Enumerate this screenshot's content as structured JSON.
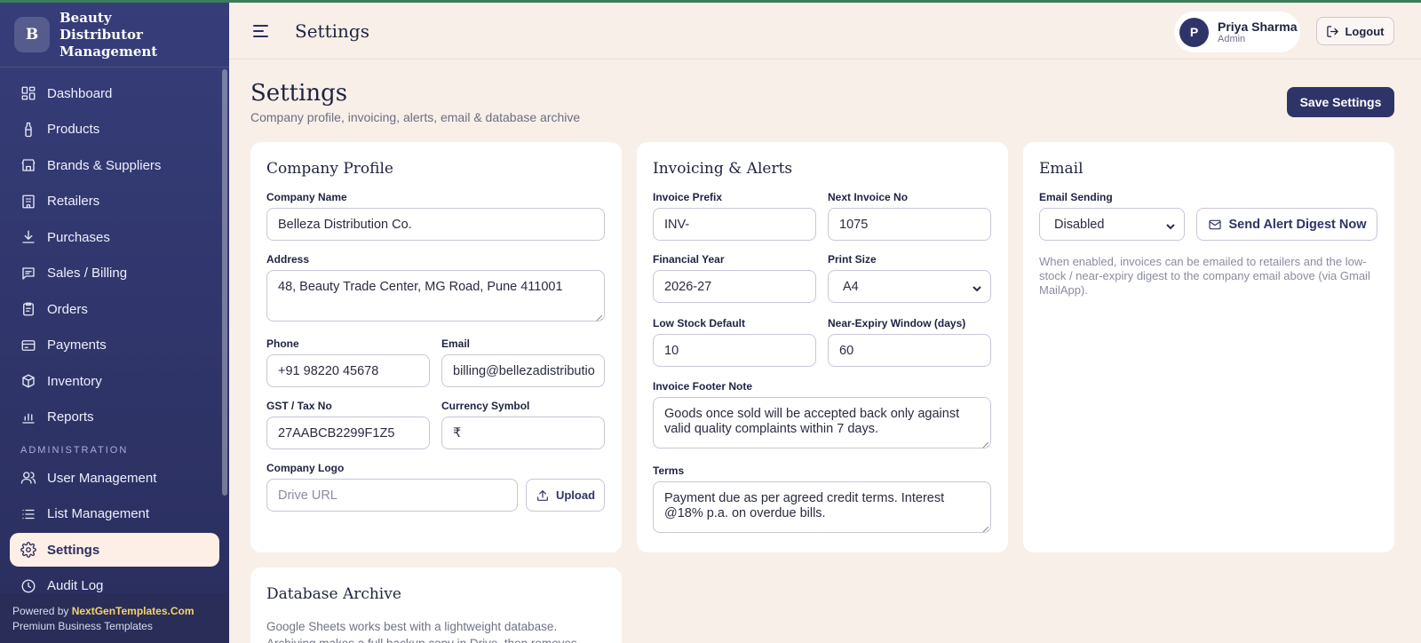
{
  "brand": {
    "logo_letter": "B",
    "name": "Beauty Distributor Management"
  },
  "sidebar": {
    "items": [
      {
        "label": "Dashboard",
        "icon": "dashboard-icon"
      },
      {
        "label": "Products",
        "icon": "bottle-icon"
      },
      {
        "label": "Brands & Suppliers",
        "icon": "store-icon"
      },
      {
        "label": "Retailers",
        "icon": "building-icon"
      },
      {
        "label": "Purchases",
        "icon": "download-icon"
      },
      {
        "label": "Sales / Billing",
        "icon": "message-icon"
      },
      {
        "label": "Orders",
        "icon": "clipboard-icon"
      },
      {
        "label": "Payments",
        "icon": "credit-card-icon"
      },
      {
        "label": "Inventory",
        "icon": "box-icon"
      },
      {
        "label": "Reports",
        "icon": "bar-chart-icon"
      }
    ],
    "section_admin": "ADMINISTRATION",
    "admin_items": [
      {
        "label": "User Management",
        "icon": "users-icon"
      },
      {
        "label": "List Management",
        "icon": "list-icon"
      },
      {
        "label": "Settings",
        "icon": "gear-icon",
        "active": true
      },
      {
        "label": "Audit Log",
        "icon": "clock-icon"
      }
    ],
    "powered_prefix": "Powered by ",
    "powered_brand": "NextGenTemplates.Com",
    "powered_tagline": "Premium Business Templates"
  },
  "header": {
    "title": "Settings",
    "user_initial": "P",
    "user_name": "Priya Sharma",
    "user_role": "Admin",
    "logout_label": "Logout"
  },
  "page": {
    "title": "Settings",
    "subtitle": "Company profile, invoicing, alerts, email & database archive",
    "save_label": "Save Settings"
  },
  "company": {
    "title": "Company Profile",
    "name_label": "Company Name",
    "name_value": "Belleza Distribution Co.",
    "address_label": "Address",
    "address_value": "48, Beauty Trade Center, MG Road, Pune 411001",
    "phone_label": "Phone",
    "phone_value": "+91 98220 45678",
    "email_label": "Email",
    "email_value": "billing@bellezadistributio",
    "gst_label": "GST / Tax No",
    "gst_value": "27AABCB2299F1Z5",
    "currency_label": "Currency Symbol",
    "currency_value": "₹",
    "logo_label": "Company Logo",
    "logo_placeholder": "Drive URL",
    "upload_label": "Upload"
  },
  "invoicing": {
    "title": "Invoicing & Alerts",
    "prefix_label": "Invoice Prefix",
    "prefix_value": "INV-",
    "next_label": "Next Invoice No",
    "next_value": "1075",
    "fy_label": "Financial Year",
    "fy_value": "2026-27",
    "print_label": "Print Size",
    "print_value": "A4",
    "lowstock_label": "Low Stock Default",
    "lowstock_value": "10",
    "expiry_label": "Near-Expiry Window (days)",
    "expiry_value": "60",
    "footer_label": "Invoice Footer Note",
    "footer_value": "Goods once sold will be accepted back only against valid quality complaints within 7 days.",
    "terms_label": "Terms",
    "terms_value": "Payment due as per agreed credit terms. Interest @18% p.a. on overdue bills."
  },
  "email": {
    "title": "Email",
    "sending_label": "Email Sending",
    "sending_value": "Disabled",
    "digest_label": "Send Alert Digest Now",
    "help": "When enabled, invoices can be emailed to retailers and the low-stock / near-expiry digest to the company email above (via Gmail MailApp)."
  },
  "archive": {
    "title": "Database Archive",
    "text": "Google Sheets works best with a lightweight database. Archiving makes a full backup copy in Drive, then removes"
  },
  "colors": {
    "sidebar": "#2f3468",
    "accent": "#2f3468",
    "background": "#f8efe8",
    "active_bg": "#fdeee6",
    "powered_brand": "#f5d36b"
  }
}
